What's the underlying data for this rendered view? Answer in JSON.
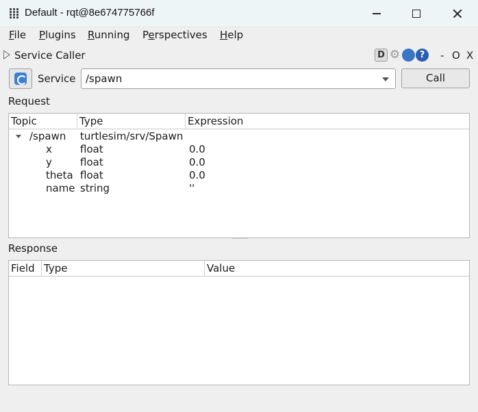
{
  "window": {
    "title": "Default - rqt@8e674775766f"
  },
  "menu": [
    {
      "pre": "",
      "u": "F",
      "post": "ile"
    },
    {
      "pre": "",
      "u": "P",
      "post": "lugins"
    },
    {
      "pre": "",
      "u": "R",
      "post": "unning"
    },
    {
      "pre": "P",
      "u": "e",
      "post": "rspectives"
    },
    {
      "pre": "",
      "u": "H",
      "post": "elp"
    }
  ],
  "plugin": {
    "title": "Service Caller",
    "d_label": "D",
    "help_label": "?",
    "dash_label": "-",
    "o_label": "O",
    "x_label": "X"
  },
  "service_row": {
    "label": "Service",
    "selected": "/spawn",
    "call_label": "Call"
  },
  "request": {
    "label": "Request",
    "columns": [
      "Topic",
      "Type",
      "Expression"
    ],
    "rows": [
      {
        "topic": "/spawn",
        "type": "turtlesim/srv/Spawn",
        "expression": ""
      },
      {
        "topic": "x",
        "type": "float",
        "expression": "0.0"
      },
      {
        "topic": "y",
        "type": "float",
        "expression": "0.0"
      },
      {
        "topic": "theta",
        "type": "float",
        "expression": "0.0"
      },
      {
        "topic": "name",
        "type": "string",
        "expression": "''"
      }
    ]
  },
  "response": {
    "label": "Response",
    "columns": [
      "Field",
      "Type",
      "Value"
    ]
  },
  "colors": {
    "titlebar": "#eef5f6",
    "window_bg": "#efefef",
    "icon_blue": "#3f7fd0"
  }
}
